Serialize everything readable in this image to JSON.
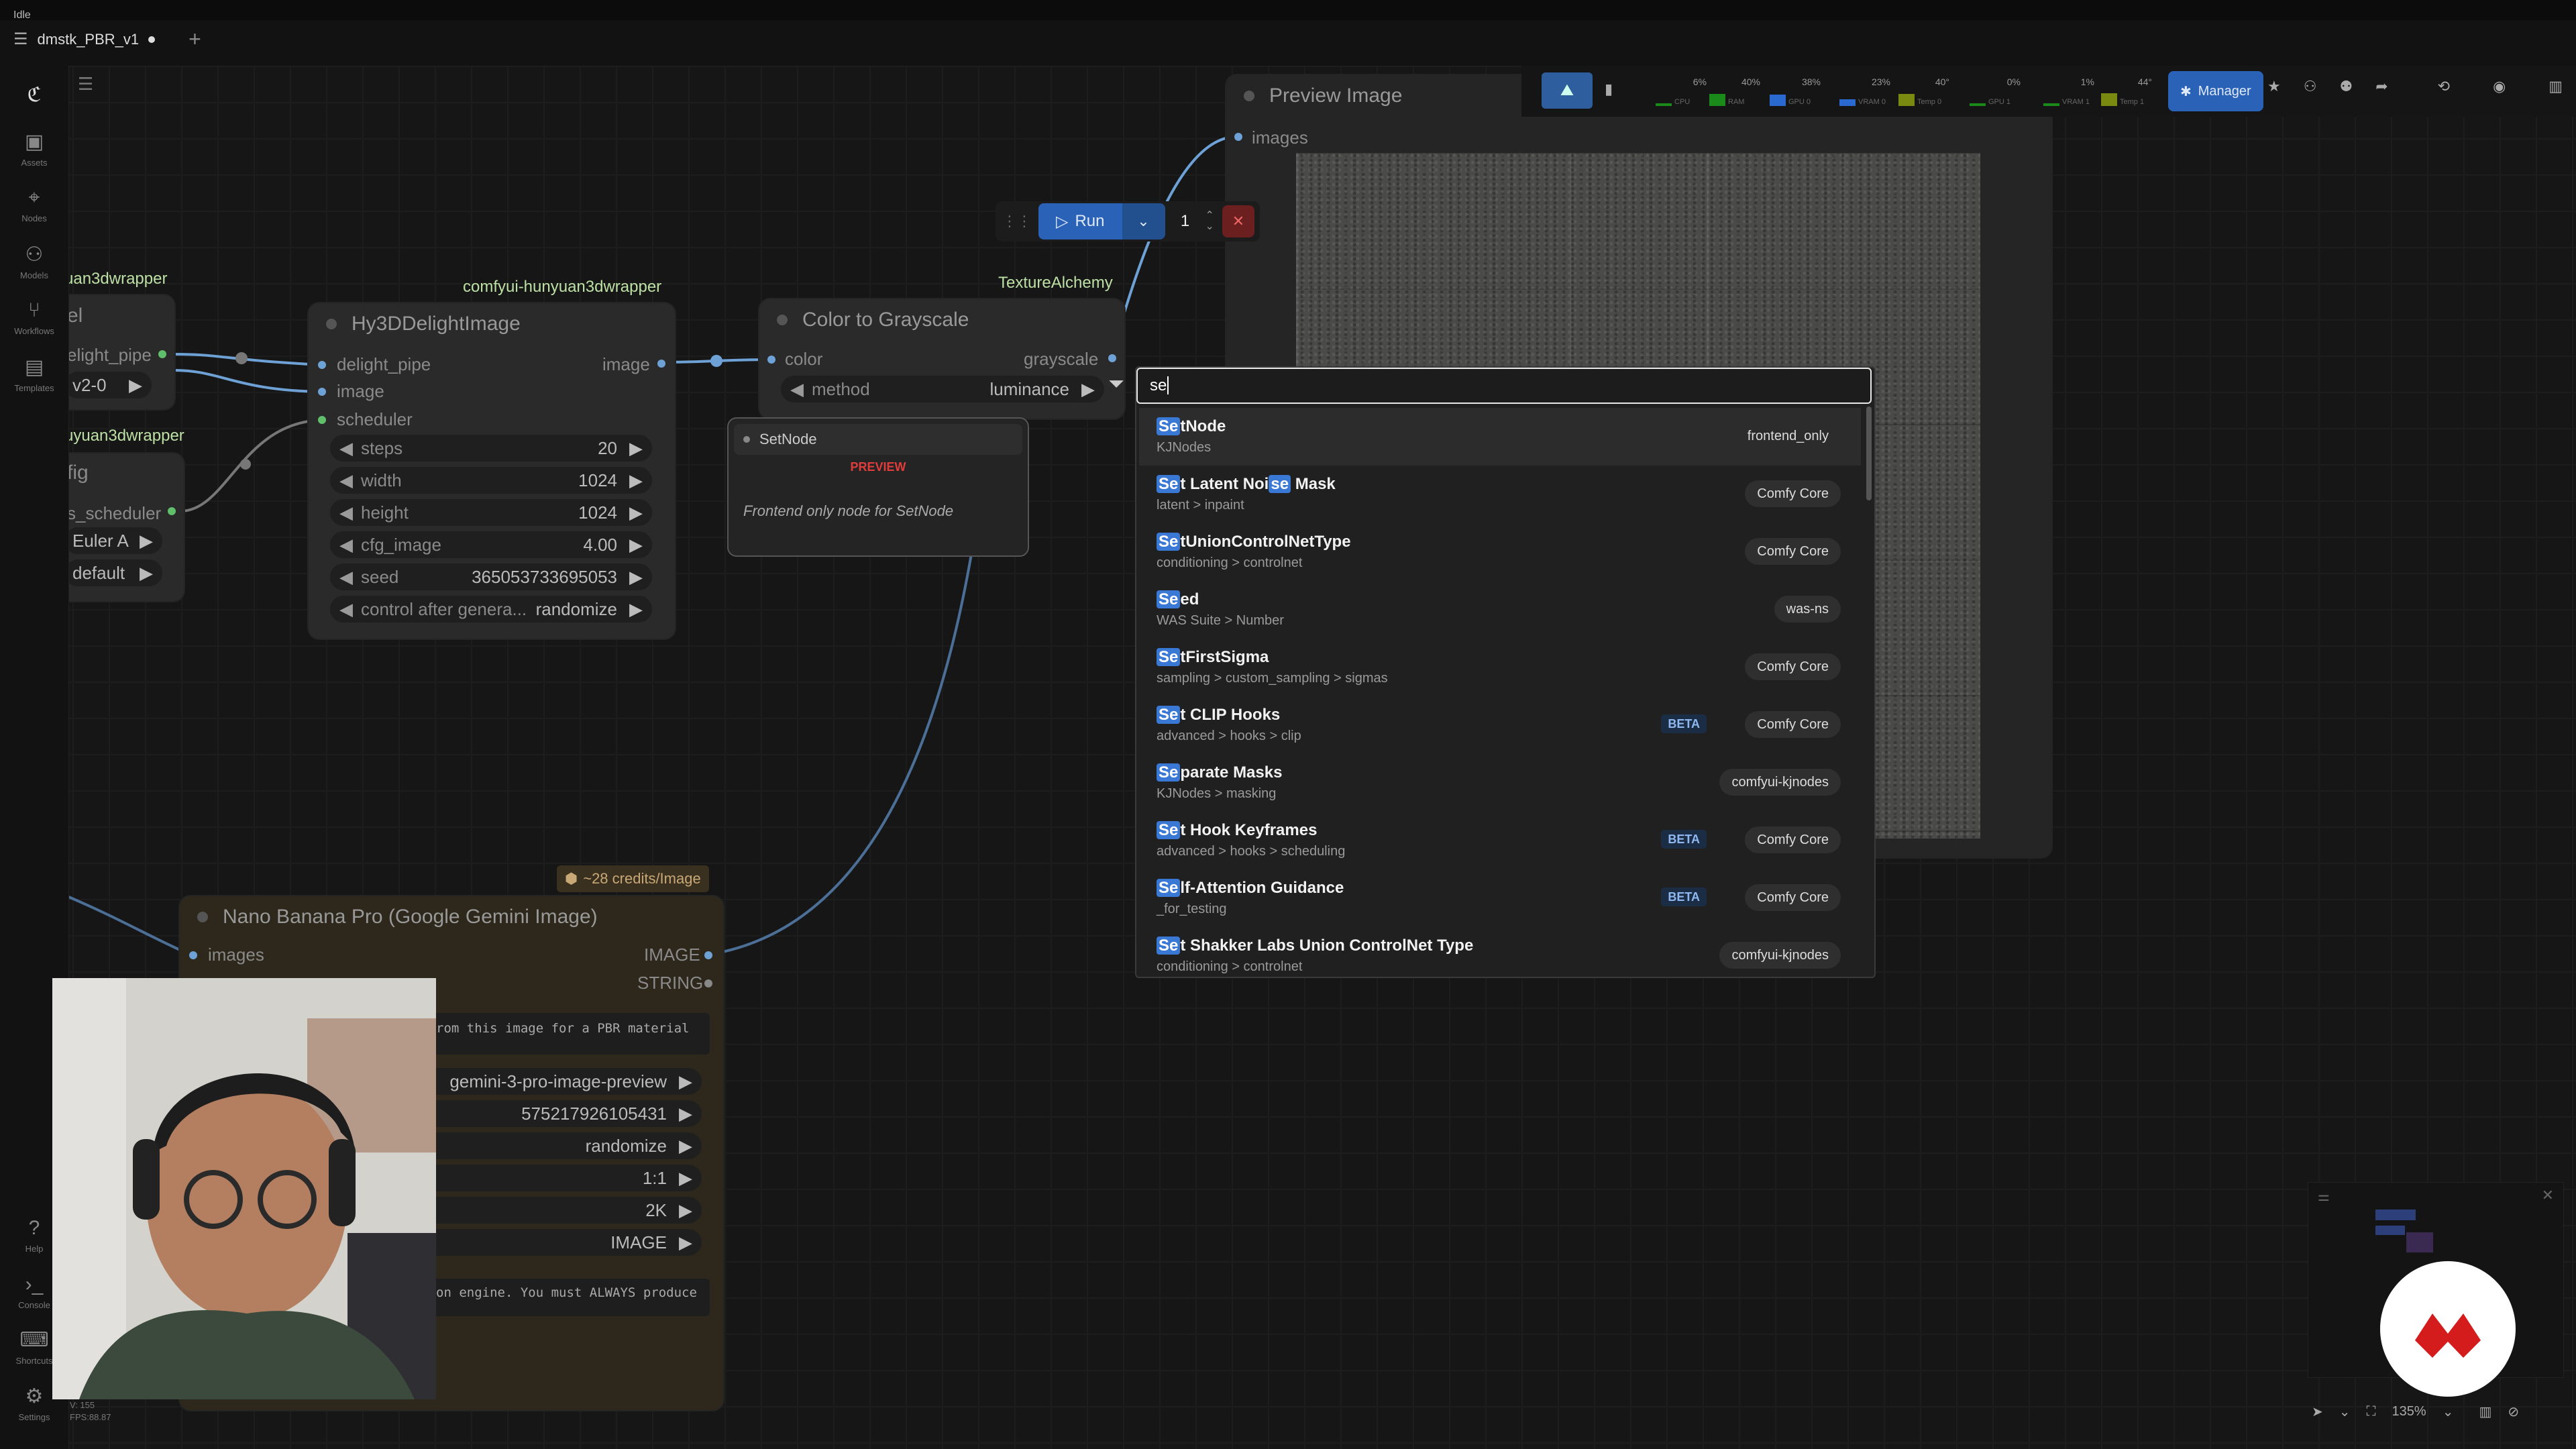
{
  "window": {
    "status": "Idle"
  },
  "tab": {
    "title": "dmstk_PBR_v1",
    "add": "+"
  },
  "sidebar": {
    "items": [
      {
        "label": "Assets"
      },
      {
        "label": "Nodes"
      },
      {
        "label": "Models"
      },
      {
        "label": "Workflows"
      },
      {
        "label": "Templates"
      }
    ],
    "bottom": [
      {
        "label": "Help"
      },
      {
        "label": "Console"
      },
      {
        "label": "Shortcuts"
      },
      {
        "label": "Settings"
      }
    ],
    "stats": {
      "v": "V: 155",
      "fps": "FPS:88.87"
    }
  },
  "toolbar": {
    "run_label": "Run",
    "batch_count": "1"
  },
  "monitor": {
    "items": [
      {
        "label": "CPU",
        "value": "6%",
        "fill": 0.06
      },
      {
        "label": "RAM",
        "value": "40%",
        "fill": 0.4
      },
      {
        "label": "GPU 0",
        "value": "38%",
        "fill": 0.38
      },
      {
        "label": "VRAM 0",
        "value": "23%",
        "fill": 0.23
      },
      {
        "label": "Temp 0",
        "value": "40°",
        "fill": 0.4
      },
      {
        "label": "GPU 1",
        "value": "0%",
        "fill": 0
      },
      {
        "label": "VRAM 1",
        "value": "1%",
        "fill": 0.01
      },
      {
        "label": "Temp 1",
        "value": "44°",
        "fill": 0.44
      }
    ],
    "manager_label": "Manager"
  },
  "nodes": {
    "left_partial": {
      "pkg1": "uan3dwrapper",
      "title1": "el",
      "port1": "elight_pipe",
      "val1": "v2-0",
      "pkg2": "uyuan3dwrapper",
      "title2": "fig",
      "port2": "s_scheduler",
      "val2": "Euler A",
      "val3": "default"
    },
    "delight": {
      "package": "comfyui-hunyuan3dwrapper",
      "title": "Hy3DDelightImage",
      "inputs": [
        "delight_pipe",
        "image",
        "scheduler"
      ],
      "output": "image",
      "widgets": [
        {
          "label": "steps",
          "value": "20"
        },
        {
          "label": "width",
          "value": "1024"
        },
        {
          "label": "height",
          "value": "1024"
        },
        {
          "label": "cfg_image",
          "value": "4.00"
        },
        {
          "label": "seed",
          "value": "365053733695053"
        },
        {
          "label": "control after genera...",
          "value": "randomize"
        }
      ]
    },
    "grayscale": {
      "package": "TextureAlchemy",
      "title": "Color to Grayscale",
      "input": "color",
      "output": "grayscale",
      "widget": {
        "label": "method",
        "value": "luminance"
      }
    },
    "preview_image": {
      "title": "Preview Image",
      "input": "images"
    },
    "nano": {
      "badge": "~28 credits/Image",
      "title": "Nano Banana Pro (Google Gemini Image)",
      "input": "images",
      "outputs": [
        "IMAGE",
        "STRING"
      ],
      "prompt_snippet": "rom this image for a PBR material",
      "widgets": [
        {
          "value": "gemini-3-pro-image-preview"
        },
        {
          "value": "575217926105431"
        },
        {
          "value": "randomize"
        },
        {
          "value": "1:1"
        },
        {
          "value": "2K"
        },
        {
          "value": "IMAGE"
        }
      ],
      "system_snippet": "on engine. You must ALWAYS produce"
    }
  },
  "tooltip": {
    "title": "SetNode",
    "tag": "PREVIEW",
    "description": "Frontend only node for SetNode"
  },
  "search": {
    "query": "se",
    "results": [
      {
        "hl": "Se",
        "rest": "tNode",
        "category": "KJNodes",
        "source": "frontend_only",
        "beta": false,
        "plain": true
      },
      {
        "hl": "Se",
        "rest": "t Latent Noi",
        "hl2": "se",
        "rest2": " Mask",
        "category": "latent > inpaint",
        "source": "Comfy Core",
        "beta": false
      },
      {
        "hl": "Se",
        "rest": "tUnionControlNetType",
        "category": "conditioning > controlnet",
        "source": "Comfy Core",
        "beta": false
      },
      {
        "hl": "Se",
        "rest": "ed",
        "category": "WAS Suite > Number",
        "source": "was-ns",
        "beta": false
      },
      {
        "hl": "Se",
        "rest": "tFirstSigma",
        "category": "sampling > custom_sampling > sigmas",
        "source": "Comfy Core",
        "beta": false
      },
      {
        "hl": "Se",
        "rest": "t CLIP Hooks",
        "category": "advanced > hooks > clip",
        "source": "Comfy Core",
        "beta": true
      },
      {
        "hl": "Se",
        "rest": "parate Masks",
        "category": "KJNodes > masking",
        "source": "comfyui-kjnodes",
        "beta": false
      },
      {
        "hl": "Se",
        "rest": "t Hook Keyframes",
        "category": "advanced > hooks > scheduling",
        "source": "Comfy Core",
        "beta": true
      },
      {
        "hl": "Se",
        "rest": "lf-Attention Guidance",
        "category": "_for_testing",
        "source": "Comfy Core",
        "beta": true
      },
      {
        "hl": "Se",
        "rest": "t Shakker Labs Union ControlNet Type",
        "category": "conditioning > controlnet",
        "source": "comfyui-kjnodes",
        "beta": false
      }
    ],
    "beta_label": "BETA"
  },
  "bottombar": {
    "zoom": "135%"
  },
  "colors": {
    "accent": "#3a78d6",
    "link": "#6ea2d6",
    "pkg": "#bde0a5",
    "danger": "#d23a3a"
  }
}
